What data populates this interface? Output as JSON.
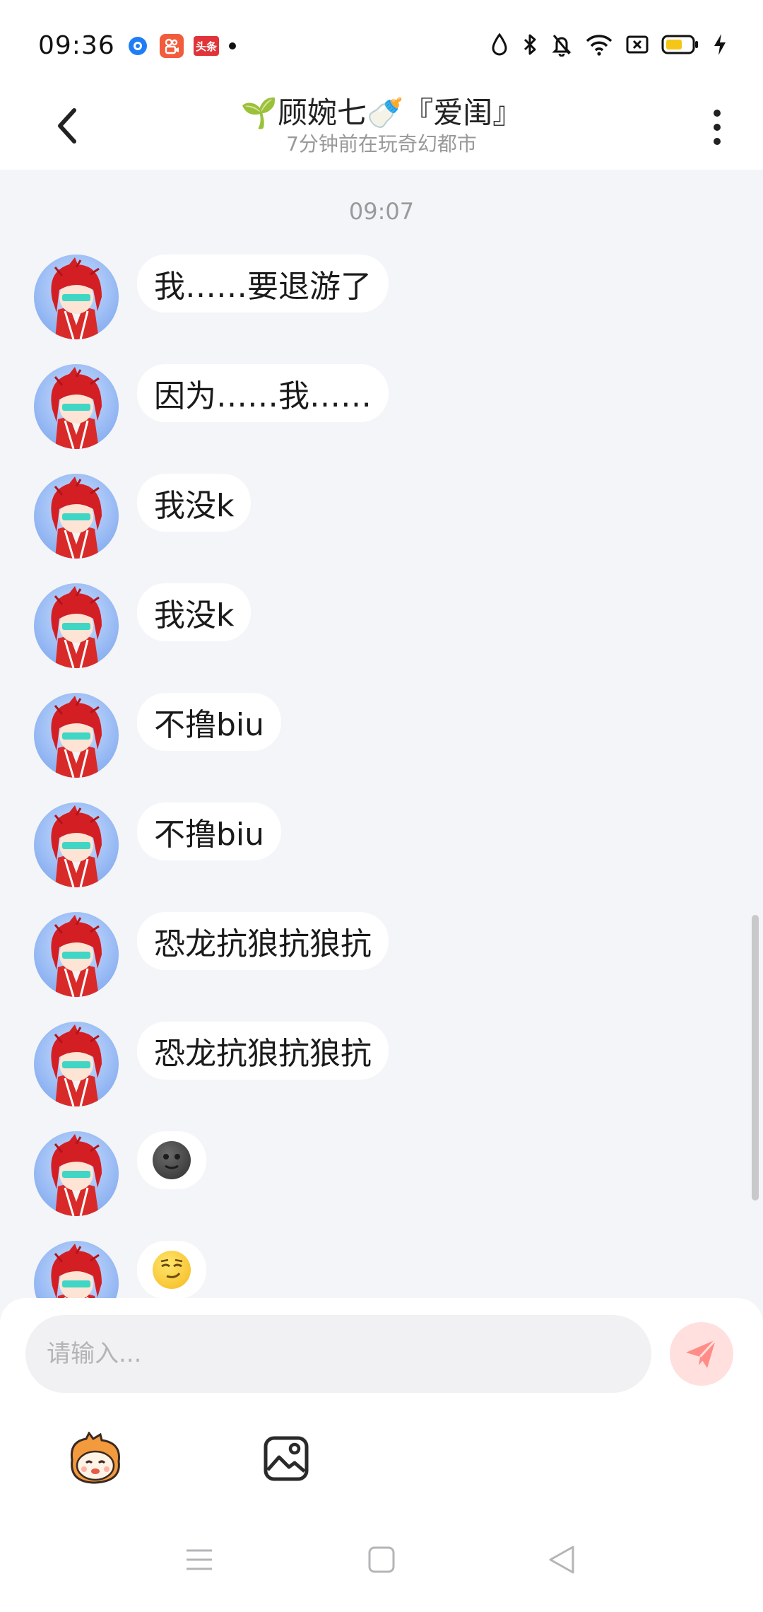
{
  "status_bar": {
    "time": "09:36",
    "apps": [
      {
        "icon": "browser-icon",
        "color": "#1f7ef5"
      },
      {
        "icon": "kuaishou-icon",
        "color": "#f25b3c"
      },
      {
        "icon": "toutiao-icon",
        "color": "#e0343a",
        "label": "头条"
      }
    ],
    "battery_color": "#f5c518"
  },
  "header": {
    "title": "🌱顾婉七🍼『爱闺』",
    "subtitle": "7分钟前在玩奇幻都市"
  },
  "chat": {
    "divider_time": "09:07",
    "messages": [
      {
        "text": "我……要退游了"
      },
      {
        "text": "因为……我……"
      },
      {
        "text": "我没k"
      },
      {
        "text": "我没k"
      },
      {
        "text": "不撸biu"
      },
      {
        "text": "不撸biu"
      },
      {
        "text": "恐龙抗狼抗狼抗"
      },
      {
        "text": "恐龙抗狼抗狼抗"
      },
      {
        "emoji": "new-moon-face"
      },
      {
        "emoji": "smirking-face"
      }
    ]
  },
  "composer": {
    "placeholder": "请输入...",
    "send_color": "#ff6b63",
    "tools": [
      "mascot-sticker-icon",
      "image-icon"
    ]
  },
  "navbar": {
    "buttons": [
      "menu-icon",
      "home-icon",
      "back-triangle-icon"
    ]
  }
}
